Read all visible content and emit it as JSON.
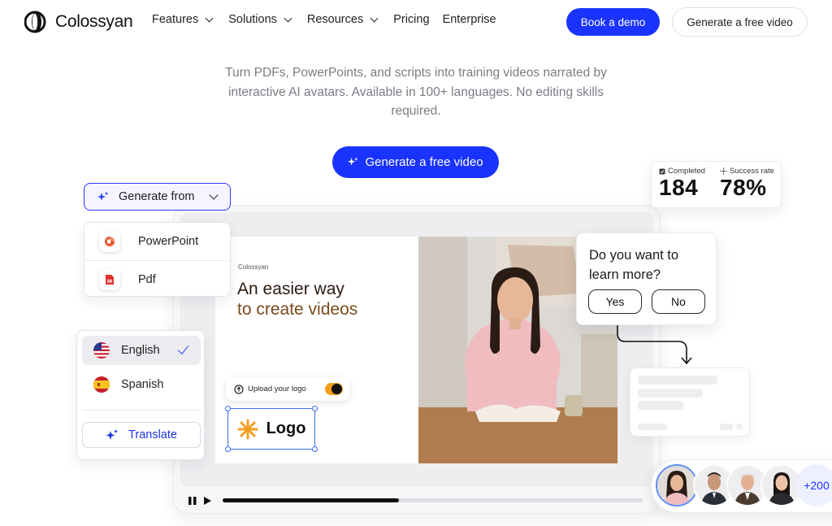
{
  "nav": {
    "brand": "Colossyan",
    "links": [
      {
        "label": "Features",
        "dropdown": true
      },
      {
        "label": "Solutions",
        "dropdown": true
      },
      {
        "label": "Resources",
        "dropdown": true
      },
      {
        "label": "Pricing",
        "dropdown": false
      },
      {
        "label": "Enterprise",
        "dropdown": false
      }
    ],
    "book_demo": "Book a demo",
    "generate_free": "Generate a free video"
  },
  "hero": {
    "subtitle": "Turn PDFs, PowerPoints, and scripts into training videos narrated by interactive  AI avatars. Available in 100+ languages. No editing skills required.",
    "cta": "Generate a free video"
  },
  "generate_from": {
    "label": "Generate from",
    "options": [
      {
        "label": "PowerPoint",
        "icon": "powerpoint-icon"
      },
      {
        "label": "Pdf",
        "icon": "pdf-icon"
      }
    ]
  },
  "stats": {
    "completed_label": "Completed",
    "completed_value": "184",
    "success_label": "Success rate",
    "success_value": "78%"
  },
  "slide": {
    "brand": "Colossyan",
    "title_line1": "An easier way",
    "title_line2": "to create videos",
    "upload_label": "Upload your logo",
    "logo_text": "Logo"
  },
  "question": {
    "text": "Do you want to learn more?",
    "yes": "Yes",
    "no": "No"
  },
  "languages": {
    "items": [
      {
        "label": "English",
        "selected": true,
        "flag": "us-flag"
      },
      {
        "label": "Spanish",
        "selected": false,
        "flag": "es-flag"
      }
    ],
    "translate": "Translate"
  },
  "avatars": {
    "more": "+200"
  },
  "player": {
    "progress": 0.42
  },
  "colors": {
    "accent": "#1a33ff",
    "highlight_orange": "#f59d1f"
  }
}
